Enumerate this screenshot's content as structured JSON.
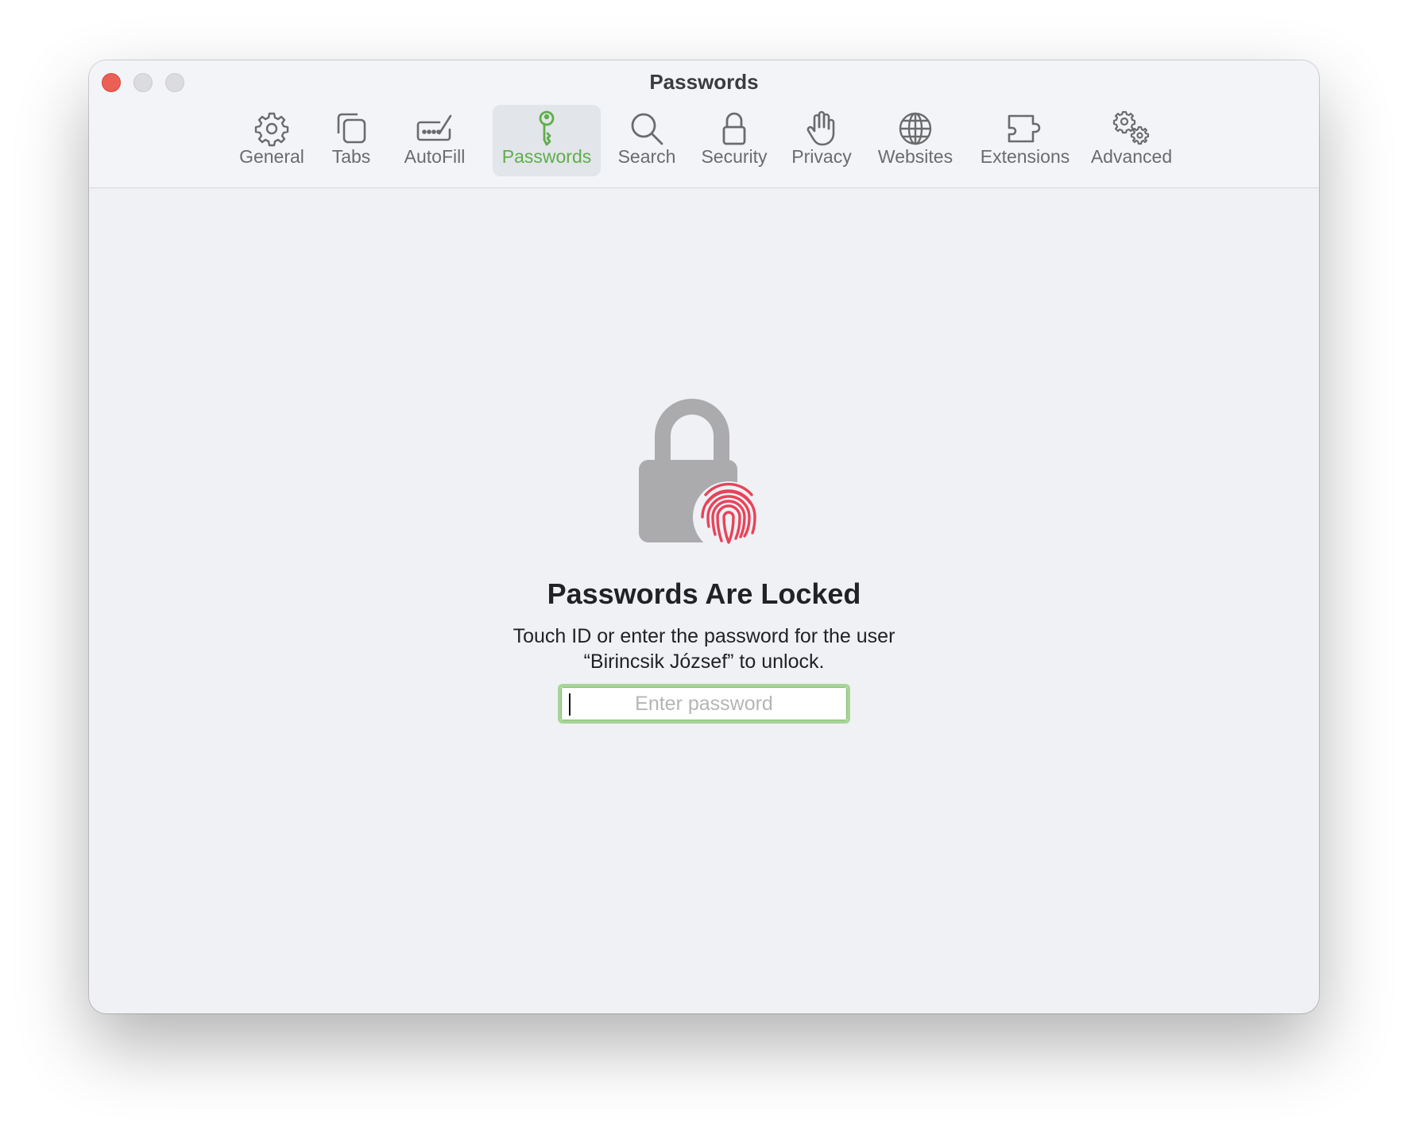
{
  "window": {
    "title": "Passwords"
  },
  "toolbar": {
    "selected": "Passwords",
    "accent_color": "#5fae4a",
    "items": [
      {
        "label": "General",
        "icon": "gear-icon"
      },
      {
        "label": "Tabs",
        "icon": "tabs-icon"
      },
      {
        "label": "AutoFill",
        "icon": "autofill-icon"
      },
      {
        "label": "Passwords",
        "icon": "key-icon"
      },
      {
        "label": "Search",
        "icon": "search-icon"
      },
      {
        "label": "Security",
        "icon": "lock-icon"
      },
      {
        "label": "Privacy",
        "icon": "hand-icon"
      },
      {
        "label": "Websites",
        "icon": "globe-icon"
      },
      {
        "label": "Extensions",
        "icon": "puzzle-icon"
      },
      {
        "label": "Advanced",
        "icon": "advanced-gears-icon"
      }
    ]
  },
  "locked": {
    "icon": "lock-with-fingerprint-icon",
    "fingerprint_color": "#e8435a",
    "title": "Passwords Are Locked",
    "message_line1": "Touch ID or enter the password for the user",
    "message_line2": "“Birincsik József” to unlock.",
    "password_placeholder": "Enter password"
  }
}
